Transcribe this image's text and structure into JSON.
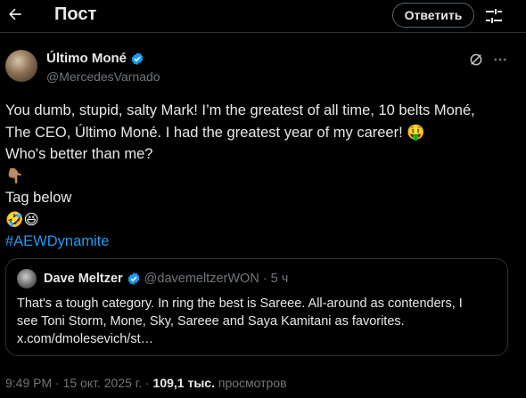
{
  "header": {
    "title": "Пост",
    "reply_label": "Ответить"
  },
  "post": {
    "author_name": "Último Moné",
    "author_handle": "@MercedesVarnado",
    "lines": [
      "You dumb, stupid, salty Mark! I’m the greatest of all time, 10 belts Moné,",
      "The CEO, Último Moné. I had the greatest year of my career! 🤑",
      "Who's better than me?",
      "👇🏽",
      "Tag below",
      "🤣😆"
    ],
    "hashtag": "#AEWDynamite"
  },
  "quote": {
    "author_name": "Dave Meltzer",
    "author_handle": "@davemeltzerWON",
    "separator": "·",
    "age": "5 ч",
    "lines": [
      "That's a tough category.  In ring the best is Sareee.  All-around as contenders, I",
      "see Toni Storm, Mone, Sky, Sareee and Saya Kamitani as favorites.",
      "x.com/dmolesevich/st…"
    ]
  },
  "footer": {
    "time": "9:49 PM",
    "sep1": "·",
    "date": "15 окт. 2025 г.",
    "sep2": "·",
    "views_count": "109,1 тыс.",
    "views_label": "просмотров"
  },
  "colors": {
    "background": "#000000",
    "text": "#e7e9ea",
    "secondary": "#71767b",
    "accent": "#1d9bf0",
    "border": "#2f3336"
  }
}
